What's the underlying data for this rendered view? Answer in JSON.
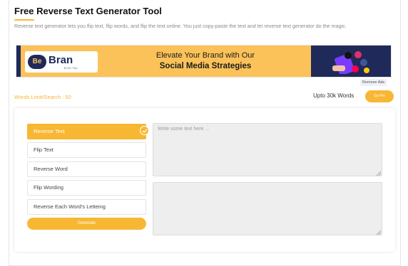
{
  "page": {
    "title": "Free Reverse Text Generator Tool",
    "description": "Reverse text generator lets you flip text, flip words, and flip the text online. You just copy-paste the text and let reverse text generator do the magic."
  },
  "banner": {
    "logo_be": "Be",
    "logo_bran": "Bran",
    "logo_sub": "DIGITAL",
    "line1": "Elevate Your Brand with Our",
    "line2": "Social Media Strategies",
    "remove_ads": "Remove Ads"
  },
  "limits": {
    "words_limit": "Words Limit/Search : 50",
    "upto": "Upto 30k Words",
    "go_pro": "Go Pro"
  },
  "options": [
    {
      "label": "Reverse Text",
      "active": true
    },
    {
      "label": "Flip Text",
      "active": false
    },
    {
      "label": "Reverse Word",
      "active": false
    },
    {
      "label": "Flip Wording",
      "active": false
    },
    {
      "label": "Reverse Each Word's Letteing",
      "active": false
    }
  ],
  "generate_label": "Generate",
  "input": {
    "placeholder": "Write some text here ...",
    "value": ""
  },
  "output": {
    "value": ""
  },
  "colors": {
    "accent": "#f7b733",
    "navy": "#1f2a5a",
    "banner_bg": "#fbc25a"
  }
}
